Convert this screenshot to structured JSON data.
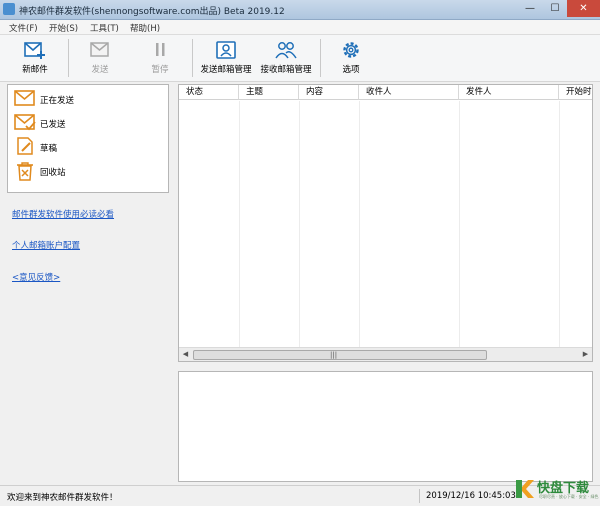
{
  "window": {
    "title": "神农邮件群发软件(shennongsoftware.com出品) Beta 2019.12",
    "controls": {
      "minimize": "—",
      "maximize": "☐",
      "close": "✕"
    }
  },
  "menu": [
    {
      "label": "文件(F)"
    },
    {
      "label": "开始(S)"
    },
    {
      "label": "工具(T)"
    },
    {
      "label": "帮助(H)"
    }
  ],
  "toolbar": {
    "new_mail": "新邮件",
    "send": "发送",
    "pause": "暂停",
    "send_mailbox": "发送邮箱管理",
    "recv_mailbox": "接收邮箱管理",
    "options": "选项",
    "accent_color": "#1f6fb8"
  },
  "folders": [
    {
      "label": "正在发送",
      "icon": "envelope-icon"
    },
    {
      "label": "已发送",
      "icon": "envelope-check-icon"
    },
    {
      "label": "草稿",
      "icon": "draft-icon"
    },
    {
      "label": "回收站",
      "icon": "trash-icon"
    }
  ],
  "links": {
    "guide": "邮件群发软件使用必读必看",
    "account": "个人邮箱账户配置",
    "feedback": "<意见反馈>"
  },
  "table": {
    "columns": [
      "状态",
      "主题",
      "内容",
      "收件人",
      "发件人",
      "开始时间"
    ],
    "rows": []
  },
  "status": {
    "message": "欢迎来到神农邮件群发软件！",
    "datetime": "2019/12/16 10:45:03"
  },
  "watermark": {
    "text": "快盘下载",
    "sub": "尽职尽责 · 放心下载 · 安全 · 绿色"
  }
}
